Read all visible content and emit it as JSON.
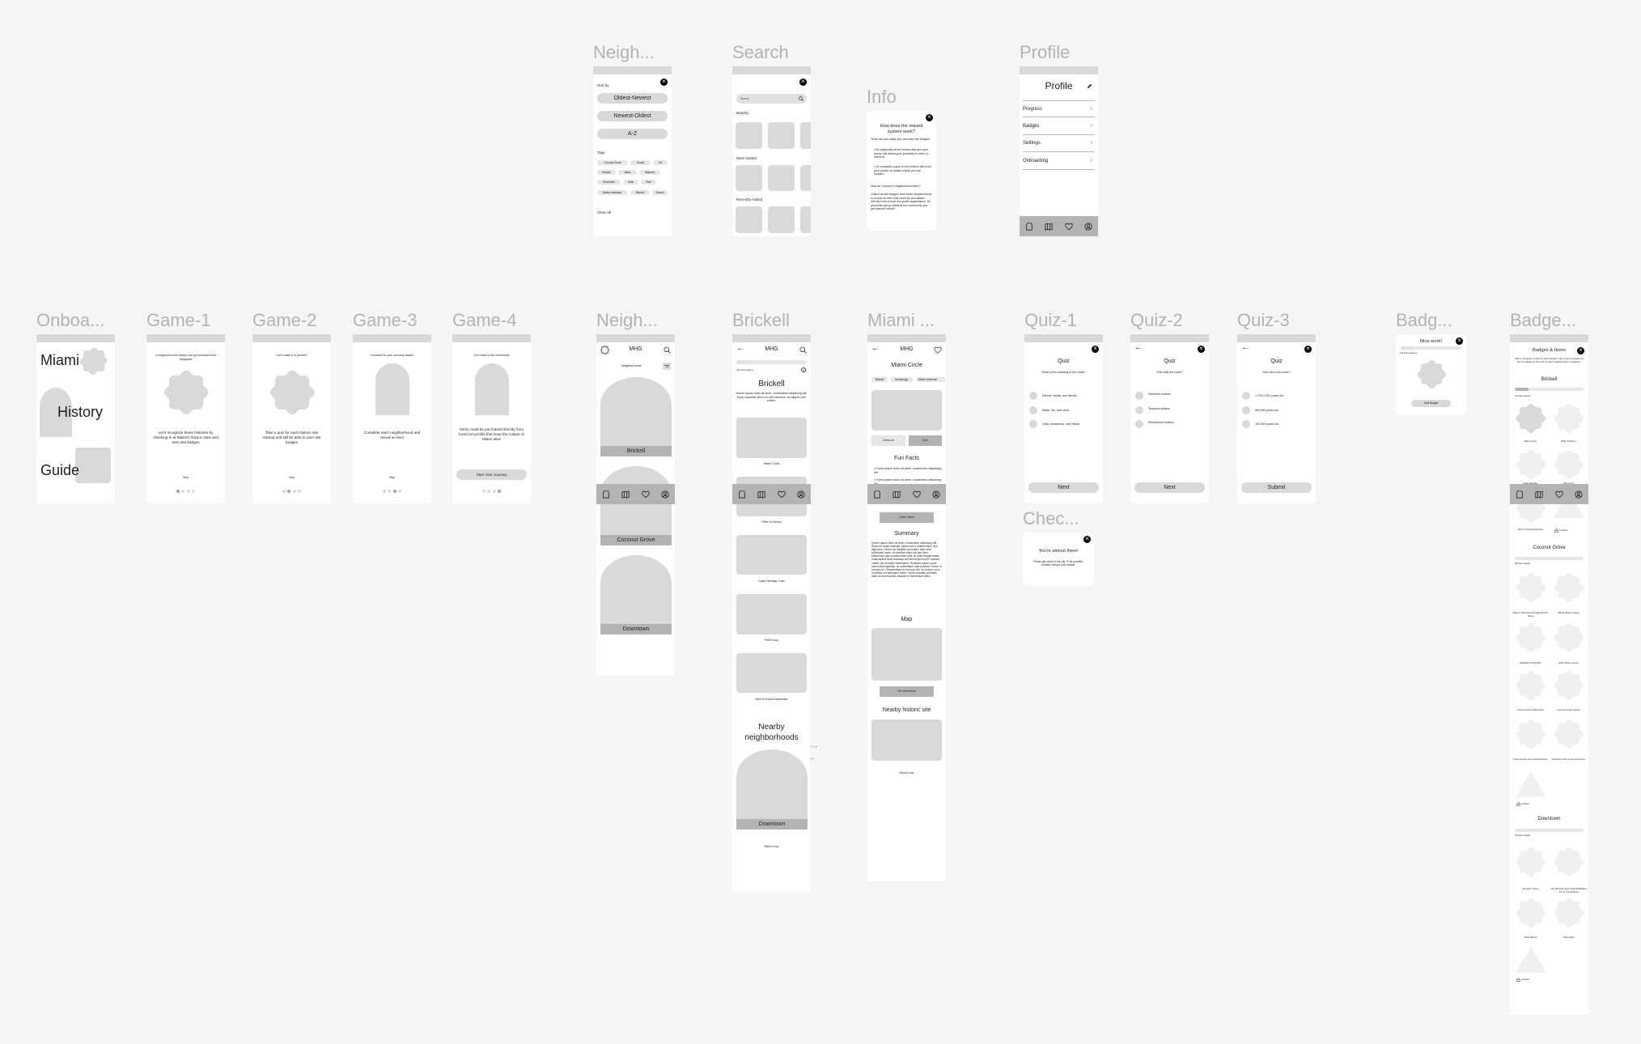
{
  "frames": {
    "onboarding": {
      "label": "Onboa...",
      "words": [
        "Miami",
        "History",
        "Guide"
      ]
    },
    "game1": {
      "label": "Game-1",
      "top": "A neighborhood's history can go unnoticed and disappear",
      "body": "Let's recognize these histories by checking-in at Miami's historic sites and earn site badges",
      "skip": "Skip",
      "page": 1
    },
    "game2": {
      "label": "Game-2",
      "top": "Can't make it in person?",
      "body": "Take a quiz for each historic site instead and still be able to earn site badges",
      "skip": "Skip",
      "page": 2
    },
    "game3": {
      "label": "Game-3",
      "top": "A reward for your curiosity awaits",
      "body": "Complete each neighborhood and reveal an item",
      "skip": "Skip",
      "page": 3
    },
    "game4": {
      "label": "Game-4",
      "top": "Give back to the community",
      "body": "Items could be purchased directly from local non-profits that keep the culture of Miami alive",
      "button": "Start Your Journey",
      "page": 4
    },
    "filter": {
      "label": "Neigh...",
      "sort_by": "Sort by",
      "sort_options": [
        "Oldest-Newest",
        "Newest-Oldest",
        "A-Z"
      ],
      "tags_label": "Tags",
      "tags": [
        "Coconut Grove",
        "House",
        "Art",
        "Women",
        "Black",
        "Hispanic",
        "Downtown",
        "Artist",
        "Park",
        "Native American",
        "Brickell",
        "School"
      ],
      "clear_all": "Clear all"
    },
    "search": {
      "label": "Search",
      "placeholder": "Search",
      "sections": [
        "Nearby",
        "Most Visited",
        "Recently Added"
      ]
    },
    "info": {
      "label": "Info",
      "title": "How does the reward system work?",
      "intro": "There are two ways you can earn site badges:",
      "bullets": [
        "Be physically at the historic site and your phone will detect your proximity in order to check-in.",
        "Or complete a quiz on the historic site from your phone no matter where you are located."
      ],
      "question": "How do I unlock a neighborhood item?",
      "answer": "Collect all site badges from each neighborhood to unlock an item that could be purchased directly from a local non-profit organization. All proceeds will go towards the community you just learned about!"
    },
    "profile": {
      "label": "Profile",
      "title": "Profile",
      "rows": [
        "Progress",
        "Badges",
        "Settings",
        "Onboarding"
      ]
    },
    "neighborhoods": {
      "label": "Neigh...",
      "app_title": "MHG",
      "subtitle": "Neighborhoods",
      "cards": [
        "Brickell",
        "Coconut Grove",
        "Downtown"
      ]
    },
    "brickell": {
      "label": "Brickell",
      "app_title": "MHG",
      "progress_text": "1/5 sites visited",
      "progress": 0.2,
      "title": "Brickell",
      "desc": "Norem ipsum dolor sit amet, consectetur adipiscing elit. Nunc vulputate libero et velit interdum, ac aliquet odio mattis.",
      "sites": [
        "Miami Circle",
        "Pillar of History",
        "Dade Heritage Trust",
        "Petit Douy",
        "Well of Ancient Mysteries"
      ],
      "nearby_title": "Nearby neighborhoods",
      "nearby": "Downtown",
      "back_to_top": "Back to top"
    },
    "miami_circle": {
      "label": "Miami ...",
      "app_title": "MHG",
      "title": "Miami Circle",
      "tags": [
        "Brickell",
        "Archeology",
        "Native American"
      ],
      "checkin": "Check-in",
      "quiz": "Quiz",
      "fun_facts": "Fun Facts",
      "facts": [
        "Forem ipsum dolor sit amet, consectetur adipiscing elit.",
        "Forem ipsum dolor sit amet, consectetur adipiscing elit."
      ],
      "learn_more": "Learn More",
      "summary_title": "Summary",
      "summary": "Qorem ipsum dolor sit amet, consectetur adipiscing elit. Etiam eu turpis molestie, dictum est a, mattis tellus. Sed dignissim, metus nec fringilla accumsan, risus sem sollicitudin lacus, ut interdum tellus elit sed risus. Maecenas eget condimentum velit, sit amet feugiat lectus. Class aptent taciti sociosqu ad litora torquent per conubia nostra, per inceptos himenaeos. Praesent auctor purus luctus enim egestas, ac scelerisque ante pulvinar. Donec ut rhoncus ex. Suspendisse ac rhoncus nisl, eu tempor urna. Curabitur vel bibendum lorem. Morbi convallis convallis diam sit amet lacinia. Aliquam in elementum tellus.",
      "map_title": "Map",
      "directions": "Get Directions",
      "nearby_title": "Nearby historic site",
      "back_to_top": "Back to top"
    },
    "quiz1": {
      "label": "Quiz-1",
      "title": "Quiz",
      "question": "What is the meaning of the circle?",
      "options": [
        "Partner, family, and friends",
        "Water, fire, and wind",
        "Unity, wholeness, and infinity"
      ],
      "button": "Next"
    },
    "quiz2": {
      "label": "Quiz-2",
      "title": "Quiz",
      "question": "Who built the circle?",
      "options": [
        "Seminole indians",
        "Tequesta indians",
        "Miccosukee indians"
      ],
      "button": "Next"
    },
    "quiz3": {
      "label": "Quiz-3",
      "title": "Quiz",
      "question": "How old is the circle?",
      "options": [
        "1,700-2,000 years old",
        "500-900 years old",
        "100-300 years old"
      ],
      "button": "Submit"
    },
    "checkin": {
      "label": "Chec...",
      "title": "You're almost there!",
      "text": "Please get closer to the site. If not possible, consider doing a quiz instead."
    },
    "badge_popup": {
      "label": "Badg...",
      "title": "Nice work!",
      "progress_text": "1/5 sites visited",
      "progress": 0.2,
      "button": "Add Badge"
    },
    "badges": {
      "label": "Badge...",
      "title": "Badges & Items",
      "desc": "Visit or complete a quiz for each historic site to earn a badge! An item is waiting at the end of each neighborhood completion.",
      "locked": "Locked",
      "groups": [
        {
          "name": "Brickell",
          "progress_text": "1/5 sites visited",
          "progress": 0.2,
          "sites": [
            "Miami Circle",
            "Pillar of History",
            "Dade Heritage",
            "Petit Douy",
            "Well of Ancient Mysteries"
          ]
        },
        {
          "name": "Coconut Grove",
          "progress_text": "0/8 sites visited",
          "progress": 0,
          "sites": [
            "Marjory Stoneman Douglas Historic Home",
            "Mariah Brown House",
            "Elizabeth Virrick Park",
            "EWF Stirrup House",
            "Coconut Grove Playhouse",
            "Coconut Grove Library",
            "First Coconut Grove Schoolhouse",
            "Woman's Club of Coconut Grove"
          ]
        },
        {
          "name": "Downtown",
          "progress_text": "0/4 sites visited",
          "progress": 0,
          "sites": [
            "Freedom Tower",
            "The David W. Dyer Federal Building & U.S. Courthouse",
            "Slide Marina",
            "Julia Tuttle"
          ]
        }
      ]
    }
  }
}
